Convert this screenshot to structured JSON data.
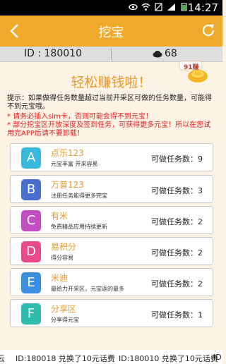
{
  "status_bar": {
    "time": "14:27",
    "icons": [
      "eye-icon",
      "wifi-icon",
      "no-sim-icon",
      "signal-icon",
      "battery-icon"
    ]
  },
  "title_bar": {
    "title": "挖宝",
    "back_icon": "chevron-left-icon",
    "refresh_icon": "refresh-icon"
  },
  "user_bar": {
    "id_text": "ID : 180010",
    "coins": "68",
    "coin_icon": "coin-pouch-icon"
  },
  "badge": {
    "label": "91赚"
  },
  "headline": "轻松赚钱啦！",
  "notices": {
    "tip": "提示：如果做得任务数量超过当前开采区可做的任务数量，可能得不到元宝哦。",
    "warn1": "* 请务必插入sim卡，否则可能会得不到元宝！",
    "warn2": "* 部分挖宝区开放深度及签到任务，可获得更多元宝！所以在您试用完APP后请不要卸载！"
  },
  "tasks": [
    {
      "letter": "A",
      "color": "#3bb8de",
      "name": "点乐123",
      "sub": "元宝丰富 开采容易",
      "count": "可做任务数：9"
    },
    {
      "letter": "B",
      "color": "#4a6fd0",
      "name": "万普123",
      "sub": "注册任务能得更多完宝",
      "count": "可做任务数：3"
    },
    {
      "letter": "C",
      "color": "#c24ec2",
      "name": "有米",
      "sub": "免费精品应用持续更新",
      "count": "可做任务数：2"
    },
    {
      "letter": "D",
      "color": "#e84a8b",
      "name": "易积分",
      "sub": "得分容易",
      "count": "可做任务数：2"
    },
    {
      "letter": "E",
      "color": "#3b8ee0",
      "name": "米迪",
      "sub": "最给力开采区，元宝返的最多",
      "count": "可做任务数：2"
    },
    {
      "letter": "F",
      "color": "#2fbcae",
      "name": "分享区",
      "sub": "分享得元宝",
      "count": "可做任务数：1"
    }
  ],
  "ticker": [
    "云",
    "ID:180018  兑换了10元话费",
    "ID:180010  兑换了10元话费",
    "ID"
  ]
}
